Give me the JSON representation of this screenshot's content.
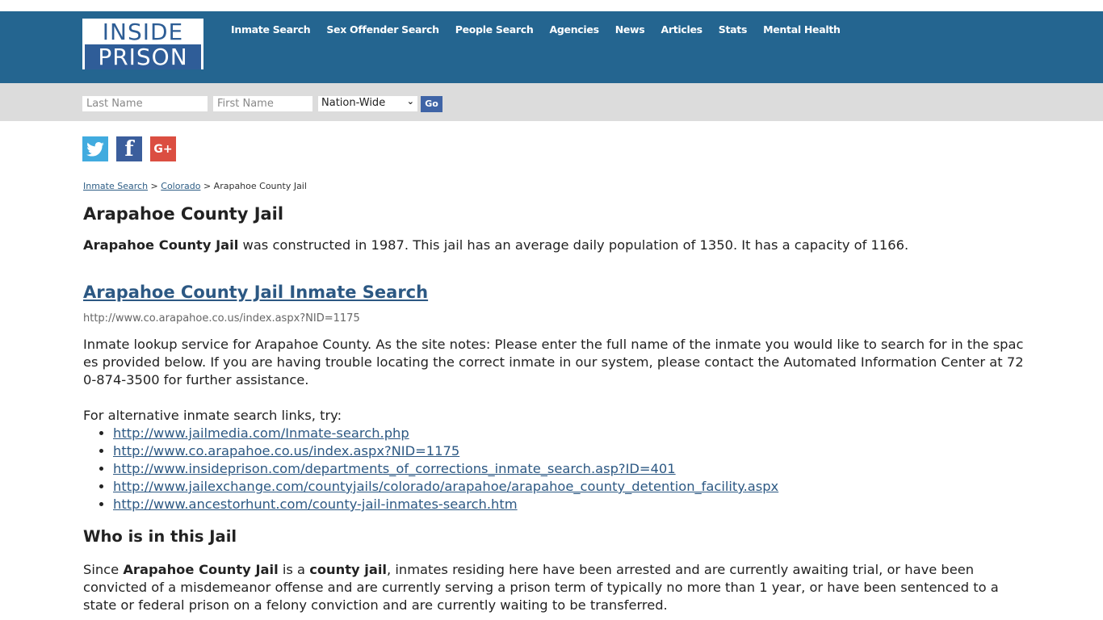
{
  "header": {
    "logo_top": "INSIDE",
    "logo_bottom": "PRISON",
    "nav": [
      {
        "label": "Inmate Search"
      },
      {
        "label": "Sex Offender Search"
      },
      {
        "label": "People Search"
      },
      {
        "label": "Agencies"
      },
      {
        "label": "News"
      },
      {
        "label": "Articles"
      },
      {
        "label": "Stats"
      },
      {
        "label": "Mental Health"
      }
    ]
  },
  "search": {
    "last_name_placeholder": "Last Name",
    "first_name_placeholder": "First Name",
    "scope_selected": "Nation-Wide",
    "go_label": "Go"
  },
  "social": {
    "twitter": "twitter-icon",
    "facebook": "facebook-icon",
    "google_plus": "google-plus-icon",
    "facebook_glyph": "f",
    "google_plus_glyph": "G+"
  },
  "breadcrumb": {
    "items": [
      "Inmate Search",
      "Colorado"
    ],
    "separator": ">",
    "current": "Arapahoe County Jail"
  },
  "main": {
    "title": "Arapahoe County Jail",
    "intro_bold": "Arapahoe County Jail",
    "intro_rest": " was constructed in 1987. This jail has an average daily population of 1350. It has a capacity of 1166.",
    "inmate_search_link": "Arapahoe County Jail Inmate Search",
    "inmate_search_url": "http://www.co.arapahoe.co.us/index.aspx?NID=1175",
    "description": "Inmate lookup service for Arapahoe County. As the site notes: Please enter the full name of the inmate you would like to search for in the spaces provided below. If you are having trouble locating the correct inmate in our system, please contact the Automated Information Center at 720-874-3500 for further assistance.",
    "alt_links_intro": "For alternative inmate search links, try:",
    "alt_links": [
      "http://www.jailmedia.com/Inmate-search.php",
      "http://www.co.arapahoe.co.us/index.aspx?NID=1175",
      "http://www.insideprison.com/departments_of_corrections_inmate_search.asp?ID=401",
      "http://www.jailexchange.com/countyjails/colorado/arapahoe/arapahoe_county_detention_facility.aspx",
      "http://www.ancestorhunt.com/county-jail-inmates-search.htm"
    ],
    "who_title": "Who is in this Jail",
    "who_p_1": "Since ",
    "who_p_bold1": "Arapahoe County Jail",
    "who_p_2": " is a ",
    "who_p_bold2": "county jail",
    "who_p_3": ", inmates residing here have been arrested and are currently awaiting trial, or have been convicted of a misdemeanor offense and are currently serving a prison term of typically no more than 1 year, or have been sentenced to a state or federal prison on a felony conviction and are currently waiting to be transferred."
  }
}
